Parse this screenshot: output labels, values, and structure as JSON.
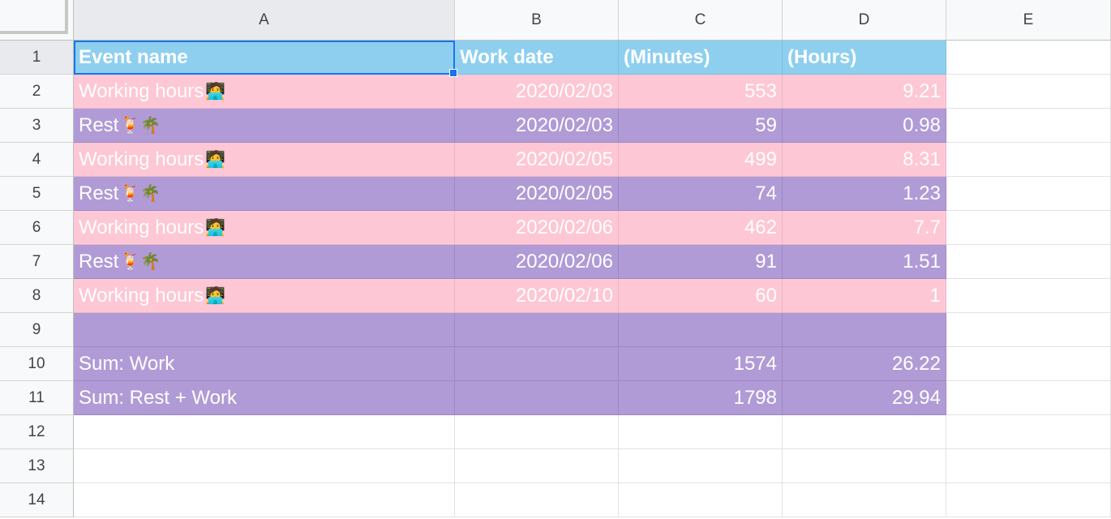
{
  "columns": [
    "A",
    "B",
    "C",
    "D",
    "E"
  ],
  "row_numbers": [
    "1",
    "2",
    "3",
    "4",
    "5",
    "6",
    "7",
    "8",
    "9",
    "10",
    "11",
    "12",
    "13",
    "14"
  ],
  "header": {
    "event_name": "Event name",
    "work_date": "Work date",
    "minutes": "(Minutes)",
    "hours": "(Hours)"
  },
  "rows": [
    {
      "event": "Working hours",
      "emoji": "🧑‍💻",
      "date": "2020/02/03",
      "minutes": "553",
      "hours": "9.21",
      "style": "pink"
    },
    {
      "event": "Rest",
      "emoji": "🍹🌴",
      "date": "2020/02/03",
      "minutes": "59",
      "hours": "0.98",
      "style": "purple"
    },
    {
      "event": "Working hours",
      "emoji": "🧑‍💻",
      "date": "2020/02/05",
      "minutes": "499",
      "hours": "8.31",
      "style": "pink"
    },
    {
      "event": "Rest",
      "emoji": "🍹🌴",
      "date": "2020/02/05",
      "minutes": "74",
      "hours": "1.23",
      "style": "purple"
    },
    {
      "event": "Working hours",
      "emoji": "🧑‍💻",
      "date": "2020/02/06",
      "minutes": "462",
      "hours": "7.7",
      "style": "pink"
    },
    {
      "event": "Rest",
      "emoji": "🍹🌴",
      "date": "2020/02/06",
      "minutes": "91",
      "hours": "1.51",
      "style": "purple"
    },
    {
      "event": "Working hours",
      "emoji": "🧑‍💻",
      "date": "2020/02/10",
      "minutes": "60",
      "hours": "1",
      "style": "pink"
    },
    {
      "event": "",
      "emoji": "",
      "date": "",
      "minutes": "",
      "hours": "",
      "style": "purple"
    },
    {
      "event": "Sum: Work",
      "emoji": "",
      "date": "",
      "minutes": "1574",
      "hours": "26.22",
      "style": "purple"
    },
    {
      "event": "Sum: Rest + Work",
      "emoji": "",
      "date": "",
      "minutes": "1798",
      "hours": "29.94",
      "style": "purple"
    }
  ],
  "colors": {
    "header_bg": "#8ecfef",
    "work_bg": "#fec7d5",
    "rest_bg": "#b09bd6",
    "selection": "#1a73e8"
  }
}
